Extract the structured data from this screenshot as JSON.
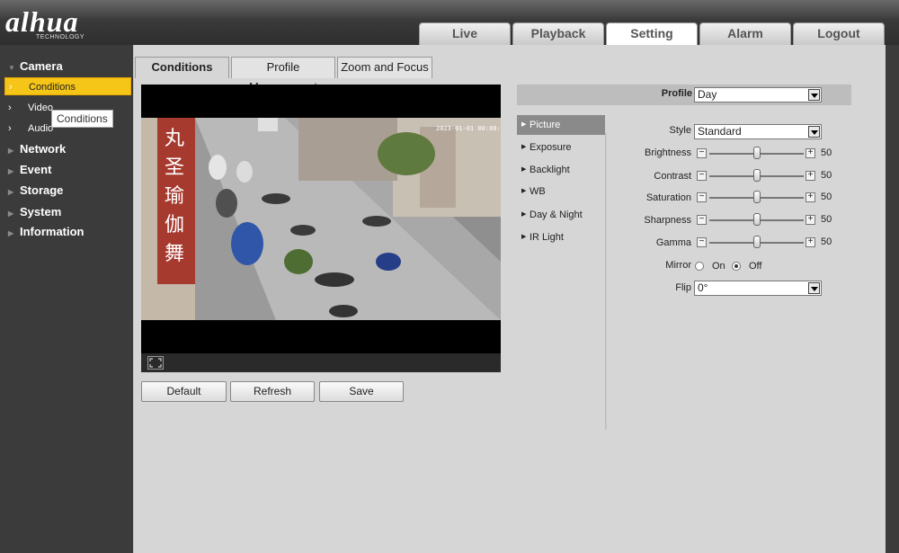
{
  "brand": {
    "logo": "alhua",
    "tagline": "TECHNOLOGY"
  },
  "nav": {
    "tabs": [
      {
        "label": "Live"
      },
      {
        "label": "Playback"
      },
      {
        "label": "Setting"
      },
      {
        "label": "Alarm"
      },
      {
        "label": "Logout"
      }
    ],
    "active": "Setting"
  },
  "sidebar": {
    "camera": "Camera",
    "sub": [
      {
        "label": "Conditions"
      },
      {
        "label": "Video"
      },
      {
        "label": "Audio"
      }
    ],
    "groups": [
      {
        "label": "Network"
      },
      {
        "label": "Event"
      },
      {
        "label": "Storage"
      },
      {
        "label": "System"
      },
      {
        "label": "Information"
      }
    ]
  },
  "tooltip": "Conditions",
  "subtabs": [
    {
      "label": "Conditions"
    },
    {
      "label": "Profile Management"
    },
    {
      "label": "Zoom and Focus"
    }
  ],
  "video": {
    "timestamp": "2023-01-01 00:00:01"
  },
  "buttons": {
    "default": "Default",
    "refresh": "Refresh",
    "save": "Save"
  },
  "profile": {
    "label": "Profile",
    "value": "Day"
  },
  "menu": [
    {
      "label": "Picture"
    },
    {
      "label": "Exposure"
    },
    {
      "label": "Backlight"
    },
    {
      "label": "WB"
    },
    {
      "label": "Day & Night"
    },
    {
      "label": "IR Light"
    }
  ],
  "picture": {
    "style": {
      "label": "Style",
      "value": "Standard"
    },
    "sliders": [
      {
        "label": "Brightness",
        "value": "50"
      },
      {
        "label": "Contrast",
        "value": "50"
      },
      {
        "label": "Saturation",
        "value": "50"
      },
      {
        "label": "Sharpness",
        "value": "50"
      },
      {
        "label": "Gamma",
        "value": "50"
      }
    ],
    "mirror": {
      "label": "Mirror",
      "on": "On",
      "off": "Off",
      "selected": "Off"
    },
    "flip": {
      "label": "Flip",
      "value": "0°"
    }
  },
  "colors": {
    "accent": "#f5c518",
    "header": "#3a3a3a",
    "sidebar": "#3b3b3b"
  }
}
